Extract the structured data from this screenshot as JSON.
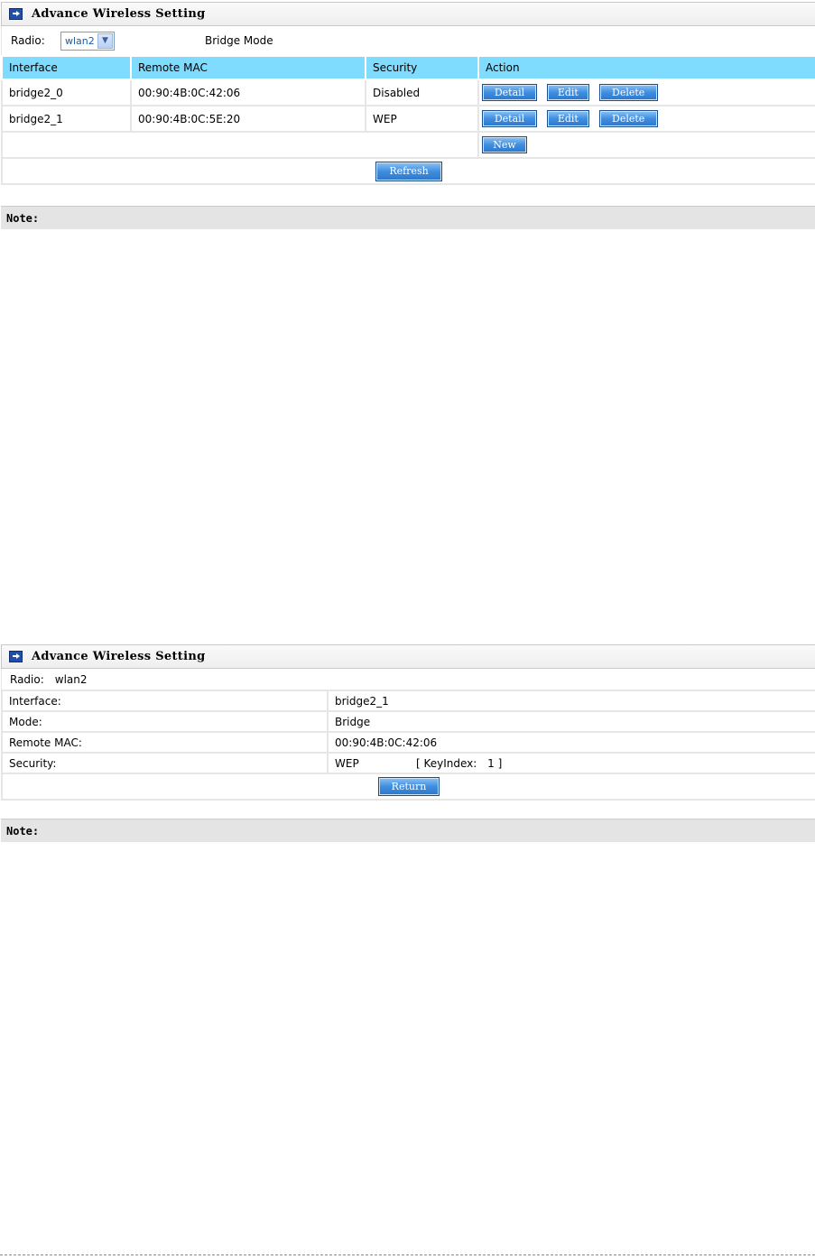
{
  "panel1": {
    "title": "Advance Wireless Setting",
    "radio_label": "Radio:",
    "radio_value": "wlan2",
    "mode_label": "Bridge Mode",
    "columns": [
      "Interface",
      "Remote MAC",
      "Security",
      "Action"
    ],
    "rows": [
      {
        "interface": "bridge2_0",
        "mac": "00:90:4B:0C:42:06",
        "security": "Disabled"
      },
      {
        "interface": "bridge2_1",
        "mac": "00:90:4B:0C:5E:20",
        "security": "WEP"
      }
    ],
    "buttons": {
      "detail": "Detail",
      "edit": "Edit",
      "delete": "Delete",
      "new": "New",
      "refresh": "Refresh"
    },
    "note": "Note:"
  },
  "panel2": {
    "title": "Advance Wireless Setting",
    "radio_label": "Radio:",
    "radio_value": "wlan2",
    "fields": [
      {
        "label": "Interface:",
        "value": "bridge2_1"
      },
      {
        "label": "Mode:",
        "value": "Bridge"
      },
      {
        "label": "Remote MAC:",
        "value": "00:90:4B:0C:42:06"
      },
      {
        "label": "Security:",
        "value": "WEP"
      }
    ],
    "key_index_open": "[ KeyIndex:",
    "key_index_value": "1",
    "key_index_close": "]",
    "return_label": "Return",
    "note": "Note:"
  },
  "icons": {
    "panel": "arrow-right-icon",
    "dropdown": "chevron-down-icon"
  }
}
